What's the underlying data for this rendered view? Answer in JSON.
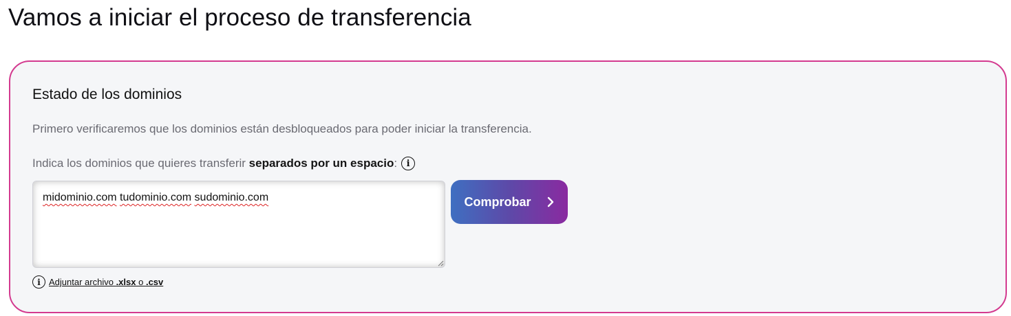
{
  "page": {
    "title": "Vamos a iniciar el proceso de transferencia"
  },
  "card": {
    "title": "Estado de los dominios",
    "description": "Primero verificaremos que los dominios están desbloqueados para poder iniciar la transferencia.",
    "prompt_prefix": "Indica los dominios que quieres transferir ",
    "prompt_bold": "separados por un espacio",
    "prompt_suffix": ":",
    "prompt_icon": "info-icon",
    "input": {
      "domains": [
        "midominio.com",
        "tudominio.com",
        "sudominio.com"
      ]
    },
    "button": {
      "label": "Comprobar",
      "icon": "chevron-right-icon"
    },
    "attach": {
      "icon": "info-icon",
      "label_prefix": "Adjuntar archivo ",
      "ext1": ".xlsx",
      "mid": " o ",
      "ext2": ".csv"
    }
  },
  "colors": {
    "card_border": "#d33a8f",
    "card_background": "#f5f6f8",
    "button_gradient_start": "#3f6fc1",
    "button_gradient_end": "#8a2aa0"
  }
}
